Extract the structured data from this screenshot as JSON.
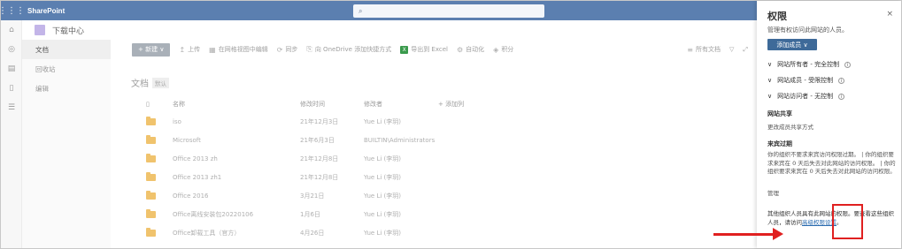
{
  "topbar": {
    "app_name": "SharePoint",
    "search_placeholder": ""
  },
  "site": {
    "title": "下载中心"
  },
  "leftnav": {
    "items": [
      {
        "label": "文档"
      },
      {
        "label": "回收站"
      },
      {
        "label": "编辑"
      }
    ]
  },
  "commandbar": {
    "new_label": "+ 新建 ∨",
    "upload": "上传",
    "edit_grid": "在网格视图中编辑",
    "sync": "同步",
    "onedrive_shortcut": "向 OneDrive 添加快捷方式",
    "export_excel": "导出到 Excel",
    "automate": "自动化",
    "integrate": "积分",
    "view": "所有文档",
    "filter_icon": "filter-icon",
    "expand_icon": "expand-icon"
  },
  "library": {
    "title": "文档",
    "badge": "默认",
    "columns": {
      "name": "名称",
      "modified": "修改时间",
      "modified_by": "修改者",
      "add_column": "+ 添加列"
    },
    "rows": [
      {
        "name": "iso",
        "modified": "21年12月3日",
        "modified_by": "Yue Li (李玥)"
      },
      {
        "name": "Microsoft",
        "modified": "21年6月3日",
        "modified_by": "BUILTIN\\Administrators"
      },
      {
        "name": "Office 2013 zh",
        "modified": "21年12月8日",
        "modified_by": "Yue Li (李玥)"
      },
      {
        "name": "Office 2013 zh1",
        "modified": "21年12月8日",
        "modified_by": "Yue Li (李玥)"
      },
      {
        "name": "Office 2016",
        "modified": "3月21日",
        "modified_by": "Yue Li (李玥)"
      },
      {
        "name": "Office离线安装包20220106",
        "modified": "1月6日",
        "modified_by": "Yue Li (李玥)"
      },
      {
        "name": "Office卸载工具（官方）",
        "modified": "4月26日",
        "modified_by": "Yue Li (李玥)"
      }
    ]
  },
  "panel": {
    "title": "权限",
    "close": "×",
    "subtitle": "管理有权访问此网站的人员。",
    "add_members": "添加成员 ∨",
    "groups": [
      {
        "label": "网站所有者 - 完全控制"
      },
      {
        "label": "网站成员 - 受限控制"
      },
      {
        "label": "网站访问者 - 无控制"
      }
    ],
    "site_sharing_title": "网站共享",
    "site_sharing_link": "更改成员共享方式",
    "expiry_title": "来宾过期",
    "expiry_text": "你的组织不要求来宾访问权限过期。 | 你的组织要求来宾在 0 天后失去对此网站的访问权限。 | 你的组织要求来宾在 0 天后失去对此网站的访问权限。",
    "manage_link": "管理",
    "bottom_text": "其他组织人员具有此网站的权限。要查看这些组织人员，请访问",
    "advanced_link": "高级权限设置",
    "bottom_end": "。"
  }
}
